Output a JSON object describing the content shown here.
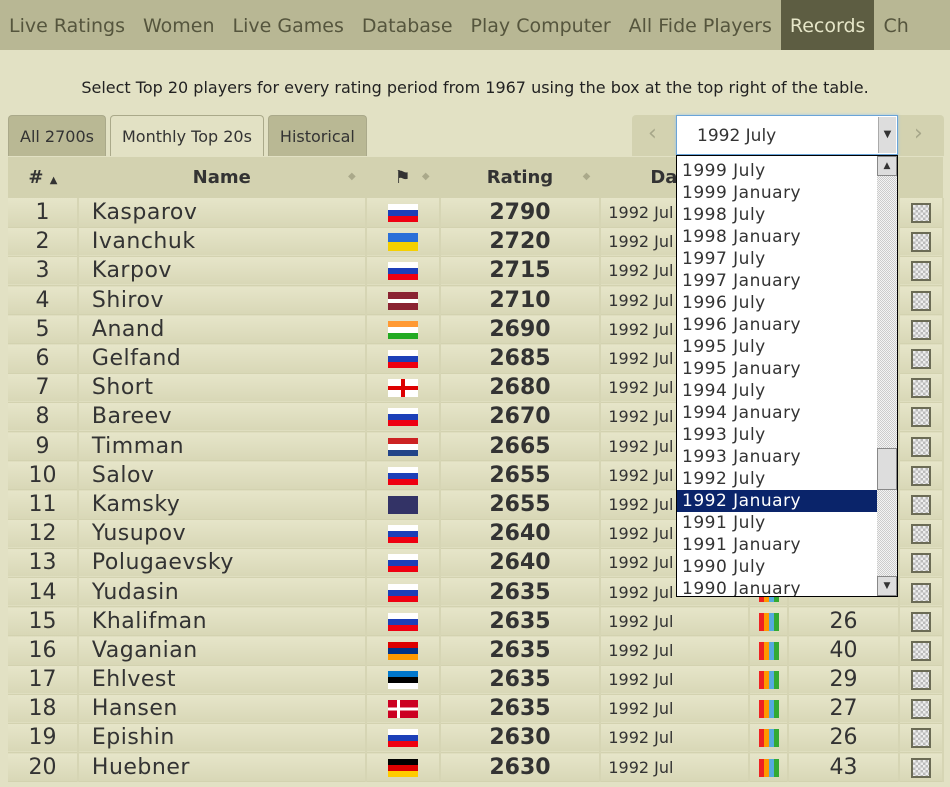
{
  "nav": [
    "Live Ratings",
    "Women",
    "Live Games",
    "Database",
    "Play Computer",
    "All Fide Players",
    "Records",
    "Ch"
  ],
  "nav_active": 6,
  "intro": "Select Top 20 players for every rating period from 1967 using the box at the top right of the table.",
  "tabs": [
    "All 2700s",
    "Monthly Top 20s",
    "Historical"
  ],
  "active_tab": 1,
  "period_select": {
    "value": "1992 July",
    "prev": "‹",
    "next": "›",
    "options": [
      "1999 July",
      "1999 January",
      "1998 July",
      "1998 January",
      "1997 July",
      "1997 January",
      "1996 July",
      "1996 January",
      "1995 July",
      "1995 January",
      "1994 July",
      "1994 January",
      "1993 July",
      "1993 January",
      "1992 July",
      "1992 January",
      "1991 July",
      "1991 January",
      "1990 July",
      "1990 January"
    ],
    "highlighted": "1992 January"
  },
  "columns": {
    "num": "#",
    "name": "Name",
    "rating": "Rating",
    "date": "Da"
  },
  "rows": [
    {
      "n": "1",
      "name": "Kasparov",
      "flag": "russia",
      "rating": "2790",
      "date": "1992 Jul",
      "games": ""
    },
    {
      "n": "2",
      "name": "Ivanchuk",
      "flag": "ukraine",
      "rating": "2720",
      "date": "1992 Jul",
      "games": ""
    },
    {
      "n": "3",
      "name": "Karpov",
      "flag": "russia",
      "rating": "2715",
      "date": "1992 Jul",
      "games": ""
    },
    {
      "n": "4",
      "name": "Shirov",
      "flag": "latvia",
      "rating": "2710",
      "date": "1992 Jul",
      "games": ""
    },
    {
      "n": "5",
      "name": "Anand",
      "flag": "india",
      "rating": "2690",
      "date": "1992 Jul",
      "games": ""
    },
    {
      "n": "6",
      "name": "Gelfand",
      "flag": "russia",
      "rating": "2685",
      "date": "1992 Jul",
      "games": ""
    },
    {
      "n": "7",
      "name": "Short",
      "flag": "england",
      "rating": "2680",
      "date": "1992 Jul",
      "games": ""
    },
    {
      "n": "8",
      "name": "Bareev",
      "flag": "russia",
      "rating": "2670",
      "date": "1992 Jul",
      "games": ""
    },
    {
      "n": "9",
      "name": "Timman",
      "flag": "netherlands",
      "rating": "2665",
      "date": "1992 Jul",
      "games": ""
    },
    {
      "n": "10",
      "name": "Salov",
      "flag": "russia",
      "rating": "2655",
      "date": "1992 Jul",
      "games": ""
    },
    {
      "n": "11",
      "name": "Kamsky",
      "flag": "usa",
      "rating": "2655",
      "date": "1992 Jul",
      "games": ""
    },
    {
      "n": "12",
      "name": "Yusupov",
      "flag": "russia",
      "rating": "2640",
      "date": "1992 Jul",
      "games": ""
    },
    {
      "n": "13",
      "name": "Polugaevsky",
      "flag": "russia",
      "rating": "2640",
      "date": "1992 Jul",
      "games": ""
    },
    {
      "n": "14",
      "name": "Yudasin",
      "flag": "russia",
      "rating": "2635",
      "date": "1992 Jul",
      "games": ""
    },
    {
      "n": "15",
      "name": "Khalifman",
      "flag": "russia",
      "rating": "2635",
      "date": "1992 Jul",
      "games": "26"
    },
    {
      "n": "16",
      "name": "Vaganian",
      "flag": "armenia",
      "rating": "2635",
      "date": "1992 Jul",
      "games": "40"
    },
    {
      "n": "17",
      "name": "Ehlvest",
      "flag": "estonia",
      "rating": "2635",
      "date": "1992 Jul",
      "games": "29"
    },
    {
      "n": "18",
      "name": "Hansen",
      "flag": "denmark",
      "rating": "2635",
      "date": "1992 Jul",
      "games": "27"
    },
    {
      "n": "19",
      "name": "Epishin",
      "flag": "russia",
      "rating": "2630",
      "date": "1992 Jul",
      "games": "26"
    },
    {
      "n": "20",
      "name": "Huebner",
      "flag": "germany",
      "rating": "2630",
      "date": "1992 Jul",
      "games": "43"
    }
  ]
}
